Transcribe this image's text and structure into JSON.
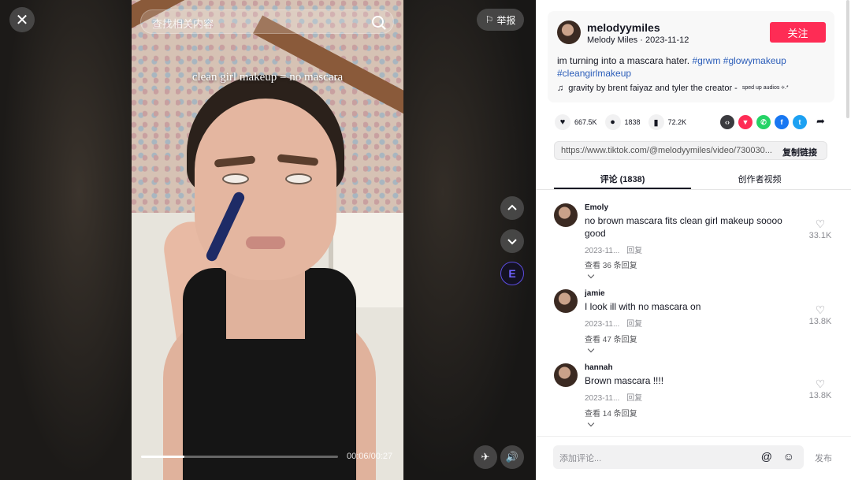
{
  "video": {
    "overlay_text": "clean girl makeup = no mascara",
    "search_placeholder": "查找相关内容",
    "report_label": "举报",
    "time": "00:06/00:27",
    "progress_fraction": 0.22
  },
  "author": {
    "username": "melodyymiles",
    "meta": "Melody Miles · 2023-11-12",
    "follow_label": "关注"
  },
  "description": {
    "text": "im turning into a mascara hater.",
    "tags": [
      "#grwm",
      "#glowymakeup",
      "#cleangirlmakeup"
    ]
  },
  "music": {
    "title": "gravity by brent faiyaz and tyler the creator -",
    "suffix": "sped up audios ⟡.*"
  },
  "stats": {
    "likes": "667.5K",
    "comments": "1838",
    "saves": "72.2K"
  },
  "share_icons": [
    {
      "name": "embed-icon",
      "glyph": "‹›",
      "color": "#3b3b3f"
    },
    {
      "name": "send-to-friends-icon",
      "glyph": "▼",
      "color": "#fe2c55"
    },
    {
      "name": "whatsapp-icon",
      "glyph": "✆",
      "color": "#25d366"
    },
    {
      "name": "facebook-icon",
      "glyph": "f",
      "color": "#1877f2"
    },
    {
      "name": "twitter-icon",
      "glyph": "t",
      "color": "#1da1f2"
    }
  ],
  "link": {
    "url": "https://www.tiktok.com/@melodyymiles/video/730030...",
    "copy_label": "复制链接"
  },
  "tabs": {
    "comments": "评论 (1838)",
    "creator_videos": "创作者视频"
  },
  "comments": [
    {
      "user": "Emoly",
      "text": "no brown mascara fits clean girl makeup soooo good",
      "date": "2023-11...",
      "reply": "回复",
      "replies": "查看 36 条回复",
      "likes": "33.1K"
    },
    {
      "user": "jamie",
      "text": "I look ill with no mascara on",
      "date": "2023-11...",
      "reply": "回复",
      "replies": "查看 47 条回复",
      "likes": "13.8K"
    },
    {
      "user": "hannah",
      "text": "Brown mascara !!!!",
      "date": "2023-11...",
      "reply": "回复",
      "replies": "查看 14 条回复",
      "likes": "13.8K"
    }
  ],
  "input": {
    "placeholder": "添加评论...",
    "post_label": "发布"
  }
}
